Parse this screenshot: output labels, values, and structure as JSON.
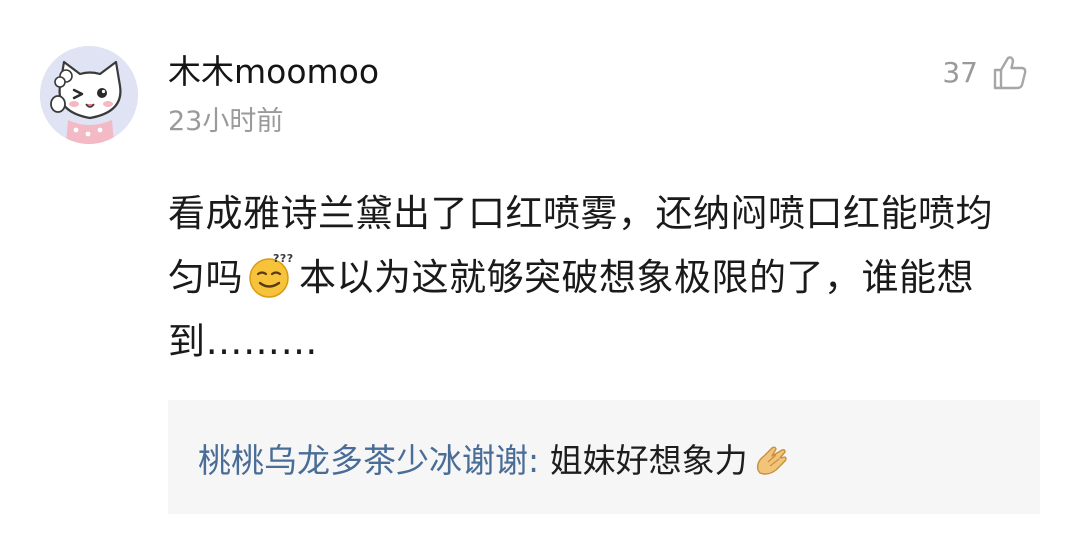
{
  "comment": {
    "username": "木木moomoo",
    "timestamp": "23小时前",
    "like_count": "37",
    "body_part1": "看成雅诗兰黛出了口红喷雾，还纳闷喷口红能喷均匀吗",
    "body_part2": "本以为这就够突破想象极限的了，谁能想到………",
    "avatar_icon": "cartoon-cat-avatar",
    "like_icon": "thumbs-up-icon",
    "inline_emoji": "confused-face-emoji"
  },
  "reply": {
    "username": "桃桃乌龙多茶少冰谢谢",
    "separator": ": ",
    "text": "姐妹好想象力",
    "emoji": "praying-hands-emoji"
  },
  "colors": {
    "username": "#151515",
    "timestamp": "#9a9a9a",
    "reply_username": "#4a6d97",
    "reply_background": "#f6f6f7"
  }
}
